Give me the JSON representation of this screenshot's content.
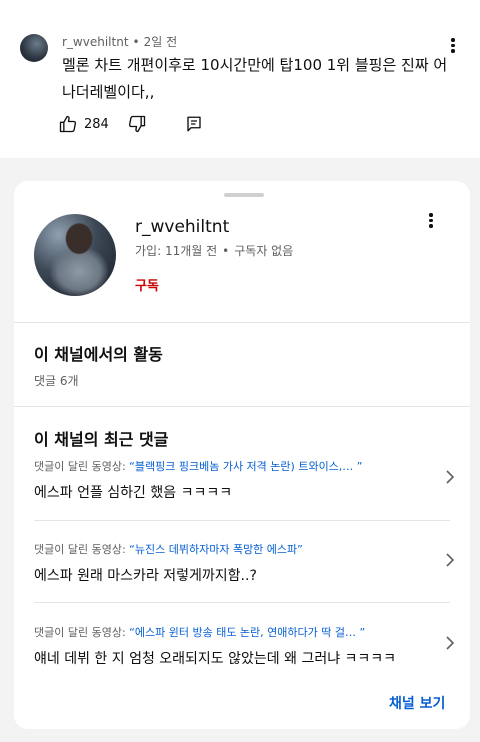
{
  "comment": {
    "username": "r_wvehiltnt",
    "separator": "•",
    "time": "2일 전",
    "text": "멜론 차트 개편이후로 10시간만에 탑100 1위 블핑은 진짜 어나더레벨이다,,",
    "like_count": "284"
  },
  "channel": {
    "name": "r_wvehiltnt",
    "joined": "가입: 11개월 전",
    "separator": "•",
    "subscribers": "구독자 없음",
    "subscribe_label": "구독"
  },
  "activity": {
    "title": "이 채널에서의 활동",
    "count": "댓글 6개"
  },
  "recent": {
    "title": "이 채널의 최근 댓글",
    "prefix": "댓글이 달린 동영상:",
    "items": [
      {
        "video": "“블랙핑크 핑크베놈 가사 저격 논란) 트와이스,… ”",
        "text": "에스파 언플 심하긴 했음 ㅋㅋㅋㅋ"
      },
      {
        "video": "“뉴진스 데뷔하자마자 폭망한 에스파”",
        "text": "에스파 원래 마스카라 저렇게까지함..?"
      },
      {
        "video": "“에스파 윈터 방송 태도 논란, 연애하다가 딱 걸… ”",
        "text": "얘네 데뷔 한 지 엄청 오래되지도 않았는데 왜 그러냐 ㅋㅋㅋㅋ"
      }
    ]
  },
  "footer": {
    "view_channel": "채널 보기"
  },
  "colors": {
    "accent_blue": "#065fd4",
    "subscribe_red": "#cc0000"
  },
  "icons": [
    "kebab-menu-icon",
    "thumbs-up-icon",
    "thumbs-down-icon",
    "reply-icon",
    "chevron-right-icon"
  ]
}
